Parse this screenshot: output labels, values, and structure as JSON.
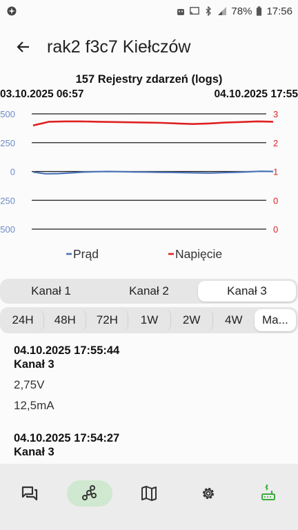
{
  "status_bar": {
    "battery": "78%",
    "time": "17:56",
    "icons": [
      "app-notification-icon",
      "android-icon",
      "cast-icon",
      "bluetooth-icon",
      "signal-icon",
      "battery-icon"
    ]
  },
  "app_bar": {
    "title": "rak2 f3c7 Kiełczów",
    "back_icon": "arrow-left-icon"
  },
  "chart": {
    "title": "157 Rejestry zdarzeń (logs)",
    "date_start": "03.10.2025 06:57",
    "date_end": "04.10.2025 17:55",
    "colors": {
      "current": "#4a72b8",
      "voltage": "#e02020",
      "grid": "#1a1a1a"
    }
  },
  "chart_data": {
    "type": "line",
    "x": [
      "03.10.2025 06:57",
      "04.10.2025 17:55"
    ],
    "y_left": {
      "ticks": [
        "500",
        "250",
        "0",
        "-250",
        "-500"
      ],
      "range": [
        -500,
        500
      ]
    },
    "y_right": {
      "ticks": [
        "3",
        "2",
        "1",
        "0",
        "0"
      ],
      "range": [
        -1,
        3
      ]
    },
    "series": [
      {
        "name": "Prąd",
        "axis": "left",
        "color": "#4a72b8",
        "values": [
          -5,
          -20,
          -18,
          -12,
          -5,
          -2,
          0,
          -2,
          -4,
          -5,
          -7,
          -8,
          -10,
          -12,
          -14,
          -10,
          -7,
          -3,
          2,
          0
        ]
      },
      {
        "name": "Napięcie",
        "axis": "right",
        "color": "#e02020",
        "values": [
          2.55,
          2.68,
          2.69,
          2.69,
          2.68,
          2.67,
          2.66,
          2.65,
          2.64,
          2.62,
          2.6,
          2.62,
          2.65,
          2.67,
          2.69,
          2.68
        ]
      }
    ],
    "legend": [
      "Prąd",
      "Napięcie"
    ],
    "grid": true,
    "legend_position": "bottom"
  },
  "channel_tabs": [
    "Kanał 1",
    "Kanał 2",
    "Kanał 3"
  ],
  "channel_active": "Kanał 3",
  "period_tabs": [
    "24H",
    "48H",
    "72H",
    "1W",
    "2W",
    "4W",
    "Ma..."
  ],
  "period_active": "Ma...",
  "logs": [
    {
      "datetime": "04.10.2025 17:55:44",
      "channel": "Kanał 3",
      "voltage": "2,75V",
      "current": "12,5mA"
    },
    {
      "datetime": "04.10.2025 17:54:27",
      "channel": "Kanał 3"
    }
  ],
  "bottom_nav": {
    "items": [
      {
        "icon": "chat-icon"
      },
      {
        "icon": "graph-icon",
        "active": true
      },
      {
        "icon": "map-icon"
      },
      {
        "icon": "gear-icon"
      },
      {
        "icon": "router-icon"
      }
    ],
    "active_color": "#cfe8cf",
    "router_color": "#3aaa3a"
  }
}
